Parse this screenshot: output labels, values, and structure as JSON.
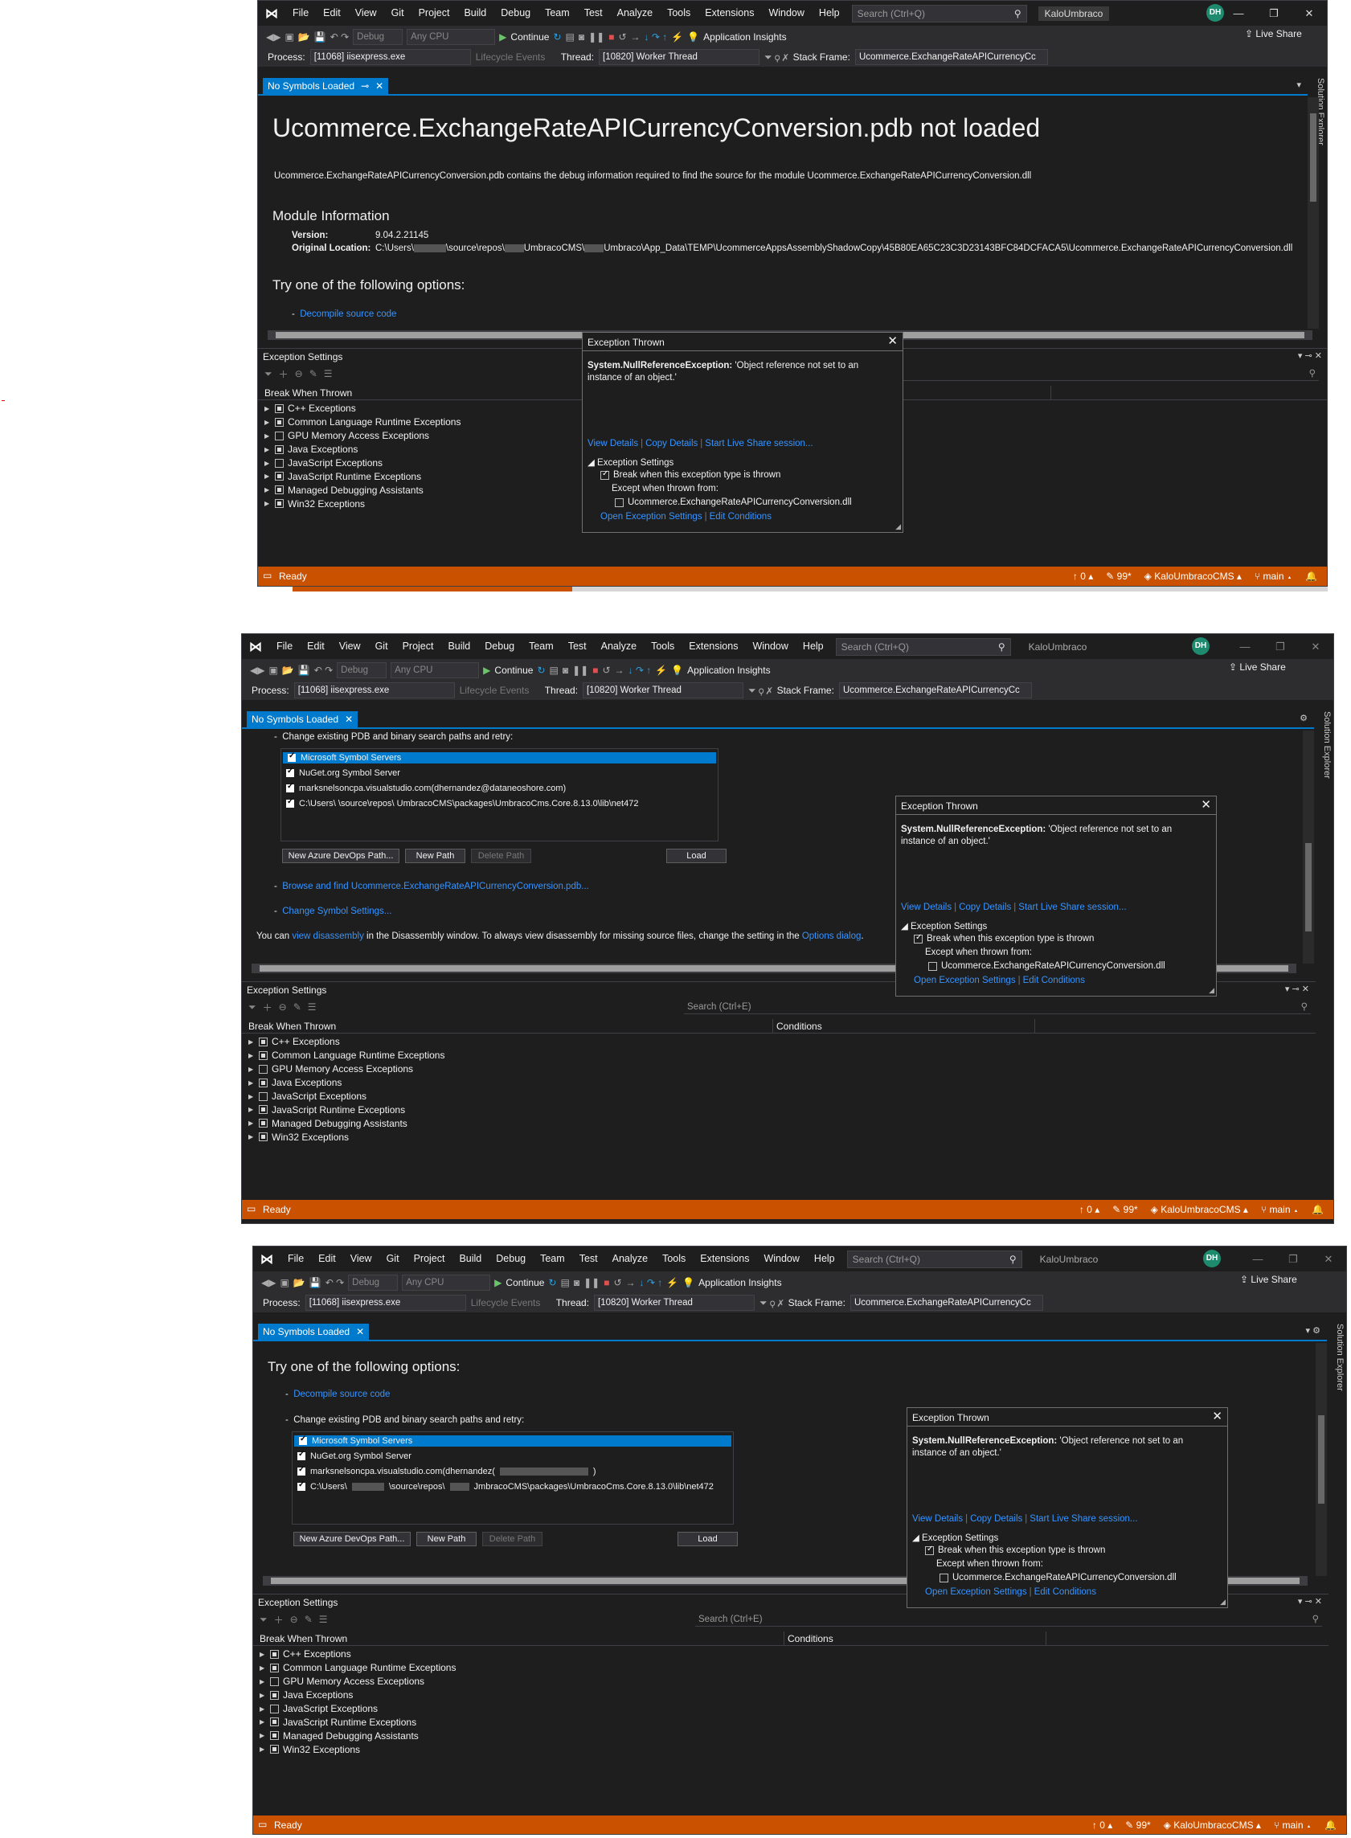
{
  "menu": [
    "File",
    "Edit",
    "View",
    "Git",
    "Project",
    "Build",
    "Debug",
    "Team",
    "Test",
    "Analyze",
    "Tools",
    "Extensions",
    "Window",
    "Help"
  ],
  "search_placeholder": "Search (Ctrl+Q)",
  "search_placeholder_2": "Search (Ctrl+Q)",
  "solution_name": "KaloUmbraco",
  "avatar_initials": "DH",
  "toolbar": {
    "config": "Debug",
    "platform": "Any CPU",
    "continue": "Continue",
    "app_insights": "Application Insights",
    "live_share": "Live Share"
  },
  "process_bar": {
    "process_label": "Process:",
    "process_value": "[11068] iisexpress.exe",
    "lifecycle": "Lifecycle Events",
    "thread_label": "Thread:",
    "thread_value": "[10820] Worker Thread",
    "stackframe_label": "Stack Frame:",
    "stackframe_value": "Ucommerce.ExchangeRateAPICurrencyCc"
  },
  "doc_tab": "No Symbols Loaded",
  "solution_explorer_tab": "Solution Explorer",
  "doc": {
    "title": "Ucommerce.ExchangeRateAPICurrencyConversion.pdb not loaded",
    "desc": "Ucommerce.ExchangeRateAPICurrencyConversion.pdb contains the debug information required to find the source for the module Ucommerce.ExchangeRateAPICurrencyConversion.dll",
    "module_info_heading": "Module Information",
    "version_label": "Version:",
    "version_value": "9.04.2.21145",
    "location_label": "Original Location:",
    "location_value_a": "C:\\Users\\",
    "location_value_b": "\\source\\repos\\",
    "location_value_c": "UmbracoCMS\\",
    "location_value_d": "Umbraco\\App_Data\\TEMP\\UcommerceAppsAssemblyShadowCopy\\45B80EA65C23C3D23143BFC84DCFACA5\\Ucommerce.ExchangeRateAPICurrencyConversion.dll",
    "options_heading": "Try one of the following options:",
    "decompile": "Decompile source code",
    "change_paths": "Change existing PDB and binary search paths and retry:",
    "browse": "Browse and find Ucommerce.ExchangeRateAPICurrencyConversion.pdb...",
    "change_symbol": "Change Symbol Settings...",
    "disasm_pre": "You can ",
    "disasm_link": "view disassembly",
    "disasm_mid": " in the Disassembly window. To always view disassembly for missing source files, change the setting in the ",
    "disasm_link2": "Options dialog",
    "disasm_end": "."
  },
  "symbol_servers": [
    "Microsoft Symbol Servers",
    "NuGet.org Symbol Server",
    "marksnelsoncpa.visualstudio.com(dhernandez@dataneoshore.com)",
    "C:\\Users\\          \\source\\repos\\          UmbracoCMS\\packages\\UmbracoCms.Core.8.13.0\\lib\\net472"
  ],
  "symbol_servers_3": {
    "s3_prefix": "marksnelsoncpa.visualstudio.com(dhernandez(",
    "s3_suffix": ")",
    "s4_a": "C:\\Users\\",
    "s4_b": "\\source\\repos\\",
    "s4_c": "JmbracoCMS\\packages\\UmbracoCms.Core.8.13.0\\lib\\net472"
  },
  "symbol_buttons": {
    "azure": "New Azure DevOps Path...",
    "new_path": "New Path",
    "delete_path": "Delete Path",
    "load": "Load"
  },
  "exception_settings": {
    "title": "Exception Settings",
    "search": "Search (Ctrl+E)",
    "col_break": "Break When Thrown",
    "col_conditions": "Conditions",
    "items": [
      {
        "label": "C++ Exceptions",
        "state": "partial"
      },
      {
        "label": "Common Language Runtime Exceptions",
        "state": "partial"
      },
      {
        "label": "GPU Memory Access Exceptions",
        "state": "none"
      },
      {
        "label": "Java Exceptions",
        "state": "partial"
      },
      {
        "label": "JavaScript Exceptions",
        "state": "none"
      },
      {
        "label": "JavaScript Runtime Exceptions",
        "state": "partial"
      },
      {
        "label": "Managed Debugging Assistants",
        "state": "partial"
      },
      {
        "label": "Win32 Exceptions",
        "state": "partial"
      }
    ]
  },
  "popup": {
    "title": "Exception Thrown",
    "exc_type": "System.NullReferenceException:",
    "exc_msg": " 'Object reference not set to an instance of an object.'",
    "view_details": "View Details",
    "copy_details": "Copy Details",
    "live_share": "Start Live Share session...",
    "settings_heading": "Exception Settings",
    "break_when": "Break when this exception type is thrown",
    "except_from": "Except when thrown from:",
    "module": "Ucommerce.ExchangeRateAPICurrencyConversion.dll",
    "open_settings": "Open Exception Settings",
    "edit_conditions": "Edit Conditions"
  },
  "status": {
    "ready": "Ready",
    "errors": "↑ 0 ▴",
    "pencil": "✎ 99*",
    "repo": "◈ KaloUmbracoCMS ▴",
    "branch": "⑂ main ▴",
    "bell": "🔔"
  },
  "colors": {
    "accent": "#007acc",
    "statusbar": "#ca5100",
    "link": "#3794ff",
    "background": "#1e1e1e"
  }
}
